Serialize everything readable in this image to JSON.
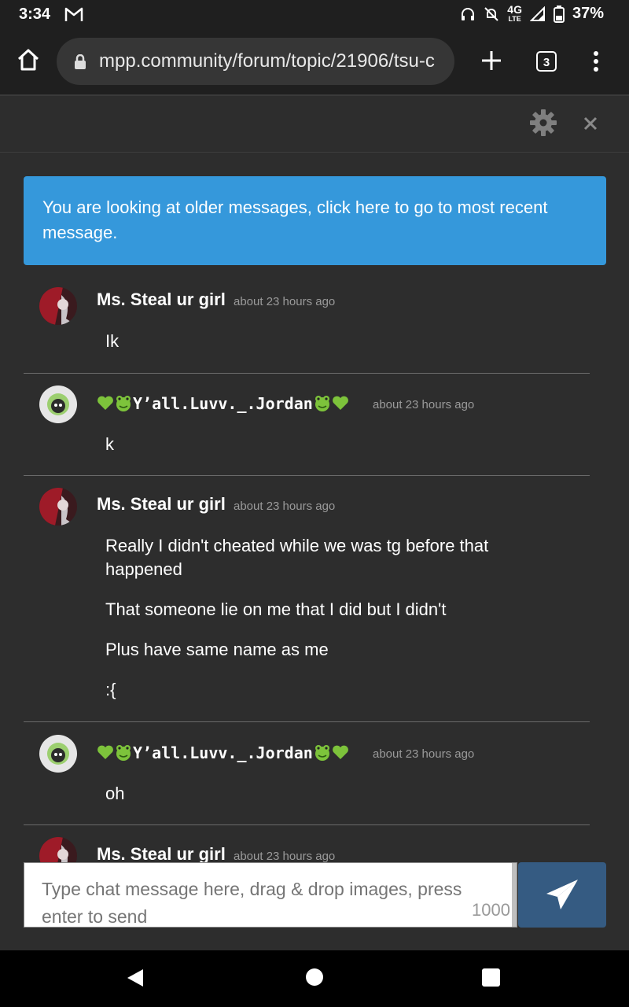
{
  "status": {
    "time": "3:34",
    "network": "4G",
    "network_sub": "LTE",
    "battery": "37%"
  },
  "browser": {
    "url": "mpp.community/forum/topic/21906/tsu-c",
    "tab_count": "3"
  },
  "banner": {
    "text": "You are looking at older messages, click here to go to most recent message."
  },
  "messages": [
    {
      "user": "Ms. Steal ur girl",
      "time": "about 23 hours ago",
      "lines": [
        "Ik"
      ]
    },
    {
      "user_text": "Y’all.Luvv._.Jordan",
      "time": "about 23 hours ago",
      "lines": [
        "k"
      ]
    },
    {
      "user": "Ms. Steal ur girl",
      "time": "about 23 hours ago",
      "lines": [
        "Really I didn't cheated while we was tg before that",
        "happened",
        "That someone lie on me that I did but I didn't",
        "Plus have same name as me",
        ":{"
      ]
    },
    {
      "user_text": "Y’all.Luvv._.Jordan",
      "time": "about 23 hours ago",
      "lines": [
        "oh"
      ]
    },
    {
      "user": "Ms. Steal ur girl",
      "time": "about 23 hours ago",
      "lines": []
    }
  ],
  "composer": {
    "placeholder": "Type chat message here, drag & drop images, press enter to send",
    "char_count": "1000"
  },
  "colors": {
    "banner": "#3598db",
    "send": "#355b82",
    "background": "#2d2d2d"
  }
}
